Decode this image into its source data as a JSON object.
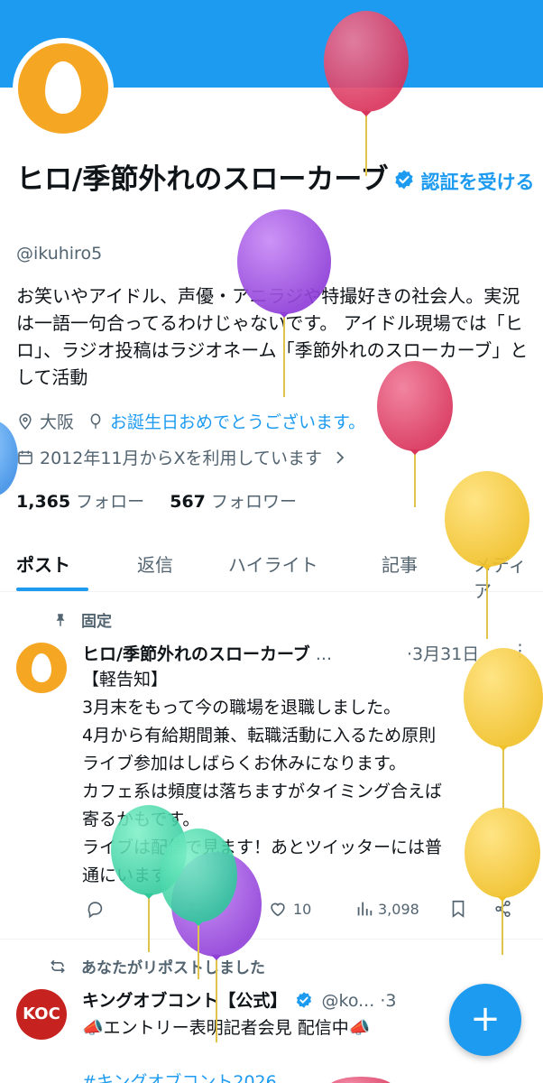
{
  "profile": {
    "name": "ヒロ/季節外れのスローカーブ",
    "verify_link": "認証を受ける",
    "handle": "@ikuhiro5",
    "bio": "お笑いやアイドル、声優・アニラジや特撮好きの社会人。実況は一語一句合ってるわけじゃないです。 アイドル現場では「ヒロ」、ラジオ投稿はラジオネーム「季節外れのスローカーブ」として活動",
    "location": "大阪",
    "birthday": "お誕生日おめでとうございます。",
    "joined": "2012年11月からXを利用しています",
    "following_count": "1,365",
    "following_label": "フォロー",
    "followers_count": "567",
    "followers_label": "フォロワー"
  },
  "tabs": [
    "ポスト",
    "返信",
    "ハイライト",
    "記事",
    "メディア"
  ],
  "pinned_label": "固定",
  "pinned_post": {
    "author": "ヒロ/季節外れのスローカーブ",
    "ellipsis": "...",
    "date": "·3月31日",
    "lines": [
      "【軽告知】",
      "3月末をもって今の職場を退職しました。",
      "4月から有給期間兼、転職活動に入るため原則",
      "ライブ参加はしばらくお休みになります。",
      "カフェ系は頻度は落ちますがタイミング合えば",
      "寄るかもです。",
      "ライブは配信で見ます！あとツイッターには普",
      "通にいます。"
    ],
    "likes": "10",
    "views": "3,098"
  },
  "repost_label": "あなたがリポストしました",
  "second_post": {
    "author": "キングオブコント【公式】",
    "handle": "@ko...",
    "date": "·3",
    "line": "📣エントリー表明記者会見 配信中📣",
    "tag": "#キングオブコント2026",
    "avatar_text": "KOC"
  },
  "fab_symbol": "+",
  "colors": {
    "accent": "#1d9bf0",
    "text": "#0f1419",
    "muted": "#536471"
  }
}
